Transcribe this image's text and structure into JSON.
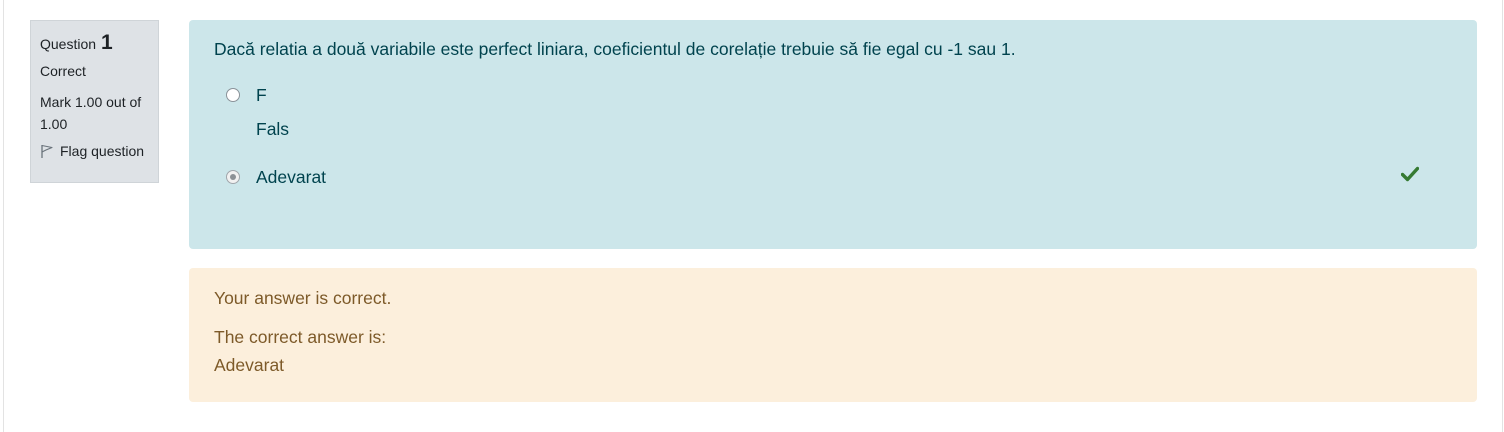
{
  "info": {
    "question_word": "Question",
    "question_number": "1",
    "state": "Correct",
    "grade": "Mark 1.00 out of 1.00",
    "flag_label": "Flag question"
  },
  "formulation": {
    "question_text": "Dacă relatia a două variabile este perfect liniara, coeficientul de corelație trebuie să fie egal cu -1 sau 1.",
    "options": [
      {
        "label": "F",
        "sublabel": "Fals",
        "selected": false
      },
      {
        "label": "Adevarat",
        "selected": true,
        "mark_icon": "check-icon"
      }
    ],
    "colors": {
      "background": "#cce6ea",
      "text": "#00434e",
      "check": "#357a32"
    }
  },
  "feedback": {
    "specific": "Your answer is correct.",
    "right_answer_label": "The correct answer is:",
    "right_answer_value": "Adevarat",
    "colors": {
      "background": "#fcefdc",
      "text": "#7d5a29"
    }
  }
}
